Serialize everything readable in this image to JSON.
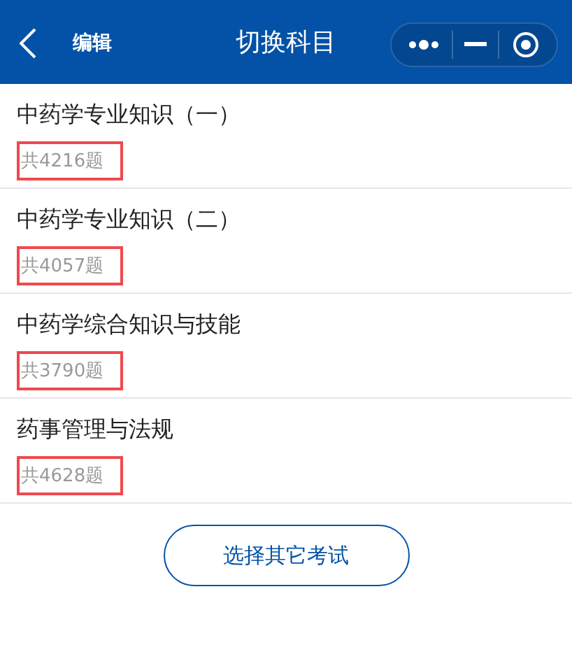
{
  "header": {
    "edit_label": "编辑",
    "title": "切换科目"
  },
  "subjects": [
    {
      "name": "中药学专业知识（一）",
      "count": "共4216题",
      "highlighted": true
    },
    {
      "name": "中药学专业知识（二）",
      "count": "共4057题",
      "highlighted": true
    },
    {
      "name": "中药学综合知识与技能",
      "count": "共3790题",
      "highlighted": true
    },
    {
      "name": "药事管理与法规",
      "count": "共4628题",
      "highlighted": true
    }
  ],
  "other_exam_button": "选择其它考试"
}
